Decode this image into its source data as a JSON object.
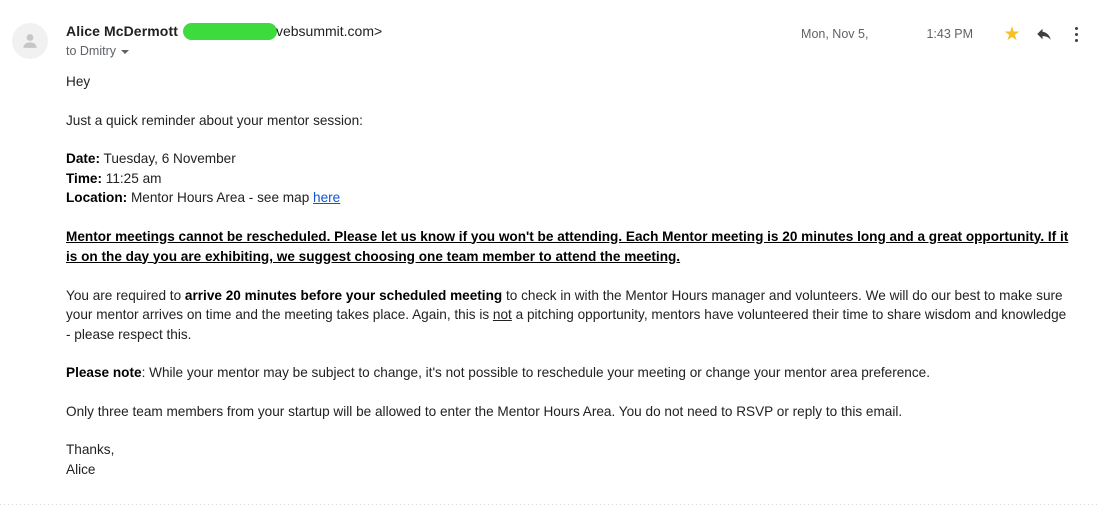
{
  "header": {
    "sender_name": "Alice McDermott",
    "sender_domain": "vebsummit.com>",
    "recipient": "to Dmitry",
    "date": "Mon, Nov 5,",
    "time": "1:43 PM",
    "star_glyph": "★",
    "colors": {
      "redaction": "#3ddc3d",
      "star": "#f4c025",
      "link": "#1155cc"
    }
  },
  "body": {
    "greeting": "Hey",
    "intro": "Just a quick reminder about your mentor session:",
    "details": {
      "date_label": "Date:",
      "date_value": " Tuesday, 6 November",
      "time_label": "Time:",
      "time_value": " 11:25 am",
      "location_label": "Location:",
      "location_value": " Mentor Hours Area - see map ",
      "location_link": "here"
    },
    "warning": "Mentor meetings cannot be rescheduled. Please let us know if you won't be attending. Each Mentor meeting is 20 minutes long and a great opportunity. If it is on the day you are exhibiting, we suggest choosing one team member to attend the meeting.",
    "arrive_paragraph": {
      "part1": "You are required to ",
      "bold": "arrive 20 minutes before your scheduled meeting",
      "part2": " to check in with the Mentor Hours manager and volunteers. We will do our best to make sure your mentor arrives on time and the meeting takes place. Again, this is ",
      "underlined": "not",
      "part3": " a pitching opportunity, mentors have volunteered their time to share wisdom and knowledge - please respect this."
    },
    "please_note": {
      "bold": "Please note",
      "rest": ": While your mentor may be subject to change, it's not possible to reschedule your meeting or change your mentor area preference."
    },
    "rsvp": "Only three team members from your startup will be allowed to enter the Mentor Hours Area. You do not need to RSVP or reply to this email.",
    "sign_off": "Thanks,",
    "signature": "Alice"
  }
}
